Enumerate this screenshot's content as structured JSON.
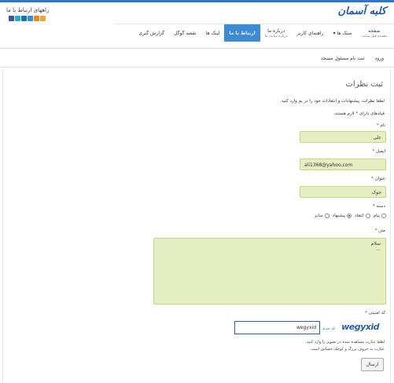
{
  "header": {
    "logo_text": "کلبه آسمان",
    "contact_title": "راههای ارتباط با ما",
    "social_icons": [
      "facebook-icon",
      "twitter-icon",
      "linkedin-icon",
      "google-icon",
      "feed-icon",
      "rss-icon"
    ]
  },
  "nav": {
    "items": [
      {
        "label": "صفحه",
        "sub": "مقدمه قبل سایت",
        "active": false
      },
      {
        "label": "سبک ها ▾",
        "sub": "",
        "active": false
      },
      {
        "label": "راهنمای کاربر",
        "sub": "",
        "active": false
      },
      {
        "label": "درباره ما",
        "sub": "درباره سایت ما",
        "active": false
      },
      {
        "label": "ارتباط با ما",
        "sub": "",
        "active": true
      },
      {
        "label": "لینک ها",
        "sub": "",
        "active": false
      },
      {
        "label": "نقشه گوگل",
        "sub": "",
        "active": false
      },
      {
        "label": "گزارش گیری",
        "sub": "",
        "active": false
      }
    ]
  },
  "subnav": {
    "login": "ورود",
    "register": "ثبت نام مسئول مسجد"
  },
  "form": {
    "title": "ثبت نظرات",
    "intro": "لطفا نظرات، پیشنهادات و انتقادات خود را در پم وارد کنید.",
    "required_note": "فیلدهای دارای * لازم هستند.",
    "name_label": "نام",
    "name_value": "علی",
    "email_label": "ایمیل",
    "email_value": "ali1368@yahoo.com",
    "subject_label": "عنوان",
    "subject_value": "جوک",
    "type_label": "دسته",
    "type_options": [
      "پیام",
      "انتقاد",
      "پیشنهاد",
      "سایر"
    ],
    "type_selected": "پیشنهاد",
    "message_label": "متن",
    "message_value": "سلام",
    "message_value2": "...",
    "captcha_label": "کد امنیتی",
    "captcha_image_text": "wegyxid",
    "captcha_reload": "کد جدید",
    "captcha_value": "wegyxid",
    "hint1": "لطفا عبارت مشاهده شده در تصویر را وارد کنید.",
    "hint2": "عبارت به حروف بزرگ و کوچک حساس است.",
    "submit_label": "ارسال"
  },
  "colors": {
    "accent": "#3d8ad6",
    "field_bg": "#e6efc2",
    "required": "#dd0000"
  }
}
